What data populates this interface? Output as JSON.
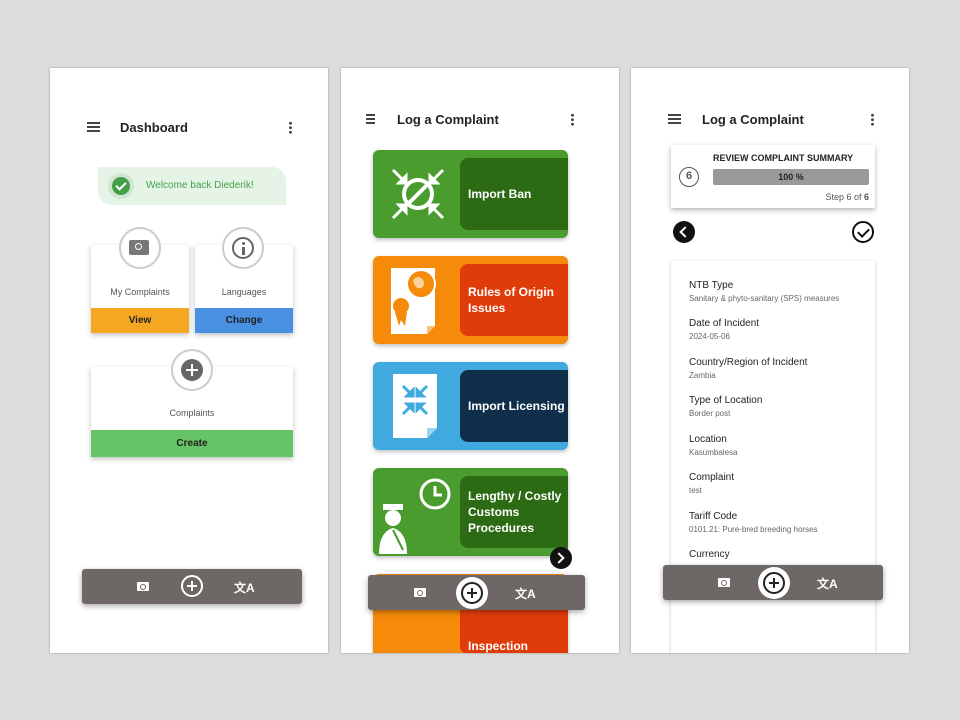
{
  "dashboard": {
    "title": "Dashboard",
    "welcome": "Welcome back Diederik!",
    "cards": [
      {
        "label": "My Complaints",
        "action": "View",
        "color": "#f5a623",
        "icon": "search-icon"
      },
      {
        "label": "Languages",
        "action": "Change",
        "color": "#4a90e2",
        "icon": "info-icon"
      },
      {
        "label": "Complaints",
        "action": "Create",
        "color": "#66c466",
        "icon": "plus-icon"
      }
    ]
  },
  "log": {
    "title": "Log a Complaint",
    "tiles": [
      {
        "name": "Import Ban",
        "bg": "#4a9c2e",
        "label_bg": "#2d6a14"
      },
      {
        "name": "Rules of Origin Issues",
        "bg": "#f58a0b",
        "label_bg": "#e03c0a"
      },
      {
        "name": "Import Licensing",
        "bg": "#3fa9e0",
        "label_bg": "#0f2e4a"
      },
      {
        "name": "Lengthy / Costly Customs Procedures",
        "bg": "#4a9c2e",
        "label_bg": "#2d6a14"
      },
      {
        "name": "Inspection",
        "bg": "#f58a0b",
        "label_bg": "#e03c0a"
      }
    ]
  },
  "review": {
    "title": "Log a Complaint",
    "step_number": "6",
    "heading": "REVIEW COMPLAINT SUMMARY",
    "progress_label": "100 %",
    "progress": 1.0,
    "step_prefix": "Step 6 of",
    "step_total": "6",
    "fields": [
      {
        "key": "NTB Type",
        "value": "Sanitary & phyto-sanitary (SPS) measures"
      },
      {
        "key": "Date of Incident",
        "value": "2024-05-06"
      },
      {
        "key": "Country/Region of Incident",
        "value": "Zambia"
      },
      {
        "key": "Type of Location",
        "value": "Border post"
      },
      {
        "key": "Location",
        "value": "Kasumbalesa"
      },
      {
        "key": "Complaint",
        "value": "test"
      },
      {
        "key": "Tariff Code",
        "value": "0101.21: Pure-bred breeding horses"
      },
      {
        "key": "Currency",
        "value": ""
      }
    ]
  },
  "bottom_nav": {
    "search_icon": "search-icon",
    "add_icon": "plus-circle-icon",
    "translate_icon": "translate-icon",
    "translate_glyph": "文A"
  }
}
